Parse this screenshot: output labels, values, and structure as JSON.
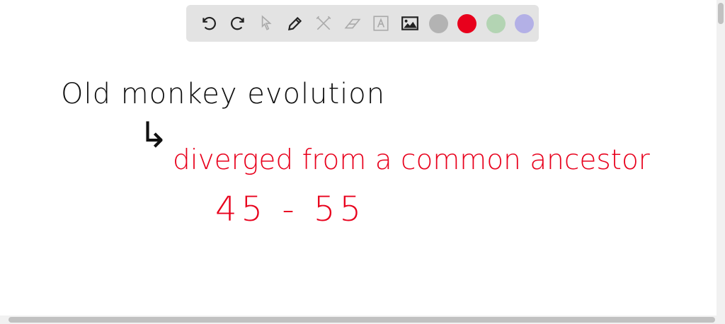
{
  "toolbar": {
    "tools": [
      "undo-icon",
      "redo-icon",
      "select-icon",
      "pen-icon",
      "tools-icon",
      "eraser-icon",
      "text-icon",
      "image-icon"
    ],
    "colors": [
      "#b3b3b3",
      "#e8001c",
      "#b3d4b3",
      "#b3b0e6"
    ],
    "active_color": "#e8001c"
  },
  "canvas": {
    "line1": "Old monkey evolution",
    "arrow": "↳",
    "line2": "diverged from a common ancestor",
    "line3": "45 - 55"
  }
}
